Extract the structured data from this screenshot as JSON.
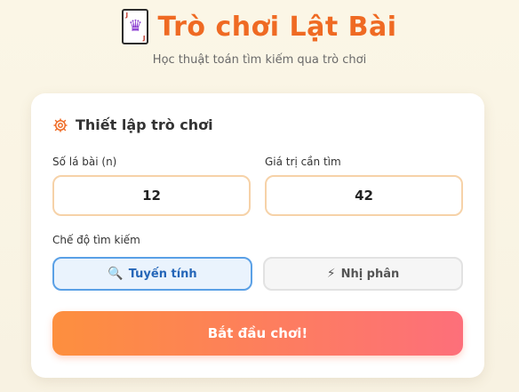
{
  "header": {
    "title": "Trò chơi Lật Bài",
    "subtitle": "Học thuật toán tìm kiếm qua trò chơi",
    "logo_icon": "joker-card-icon"
  },
  "setup": {
    "title": "Thiết lập trò chơi",
    "icon": "gear-icon",
    "card_count_label": "Số lá bài (n)",
    "card_count_value": "12",
    "target_label": "Giá trị cần tìm",
    "target_value": "42",
    "mode_label": "Chế độ tìm kiếm",
    "modes": [
      {
        "icon": "🔍",
        "label": "Tuyến tính",
        "selected": true
      },
      {
        "icon": "⚡",
        "label": "Nhị phân",
        "selected": false
      }
    ],
    "start_label": "Bắt đầu chơi!"
  },
  "colors": {
    "accent": "#ef6a23",
    "field_border": "#f6d2a8",
    "active_mode_border": "#5aa0e6",
    "gradient_start": "#fd8f3e",
    "gradient_end": "#fd6f7a"
  }
}
